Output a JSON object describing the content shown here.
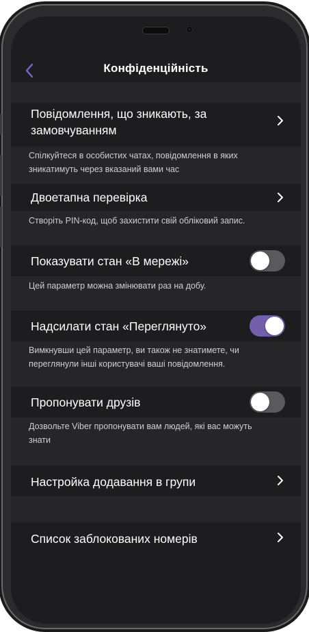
{
  "title": "Конфіденційність",
  "colors": {
    "background": "#1d1c1f",
    "section": "#262528",
    "accent": "#7260ad",
    "toggle_off": "#5a595e"
  },
  "icons": {
    "back": "chevron-left-icon",
    "disclosure": "chevron-right-icon"
  },
  "items": [
    {
      "label_line1": "Повідомлення, що зникають, за",
      "label_line2": "замовчуванням",
      "control": "chevron",
      "desc_line1": "Спілкуйтеся в особистих чатах, повідомлення в яких",
      "desc_line2": "зникатимуть через вказаний вами час"
    },
    {
      "label": "Двоетапна перевірка",
      "control": "chevron",
      "desc_line1": "Створіть PIN-код, щоб захистити свій обліковий запис."
    },
    {
      "label": "Показувати стан «В мережі»",
      "control": "toggle",
      "enabled": false,
      "desc_line1": "Цей параметр можна змінювати раз на добу."
    },
    {
      "label": "Надсилати стан «Переглянуто»",
      "control": "toggle",
      "enabled": true,
      "desc_line1": "Вимкнувши цей параметр, ви також не знатимете, чи",
      "desc_line2": "переглянули інші користувачі ваші повідомлення."
    },
    {
      "label": "Пропонувати друзів",
      "control": "toggle",
      "enabled": false,
      "desc_line1": "Дозвольте Viber пропонувати вам людей, які вас можуть",
      "desc_line2": "знати"
    },
    {
      "label": "Настройка додавання в групи",
      "control": "chevron"
    },
    {
      "label": "Список заблокованих номерів",
      "control": "chevron"
    }
  ]
}
